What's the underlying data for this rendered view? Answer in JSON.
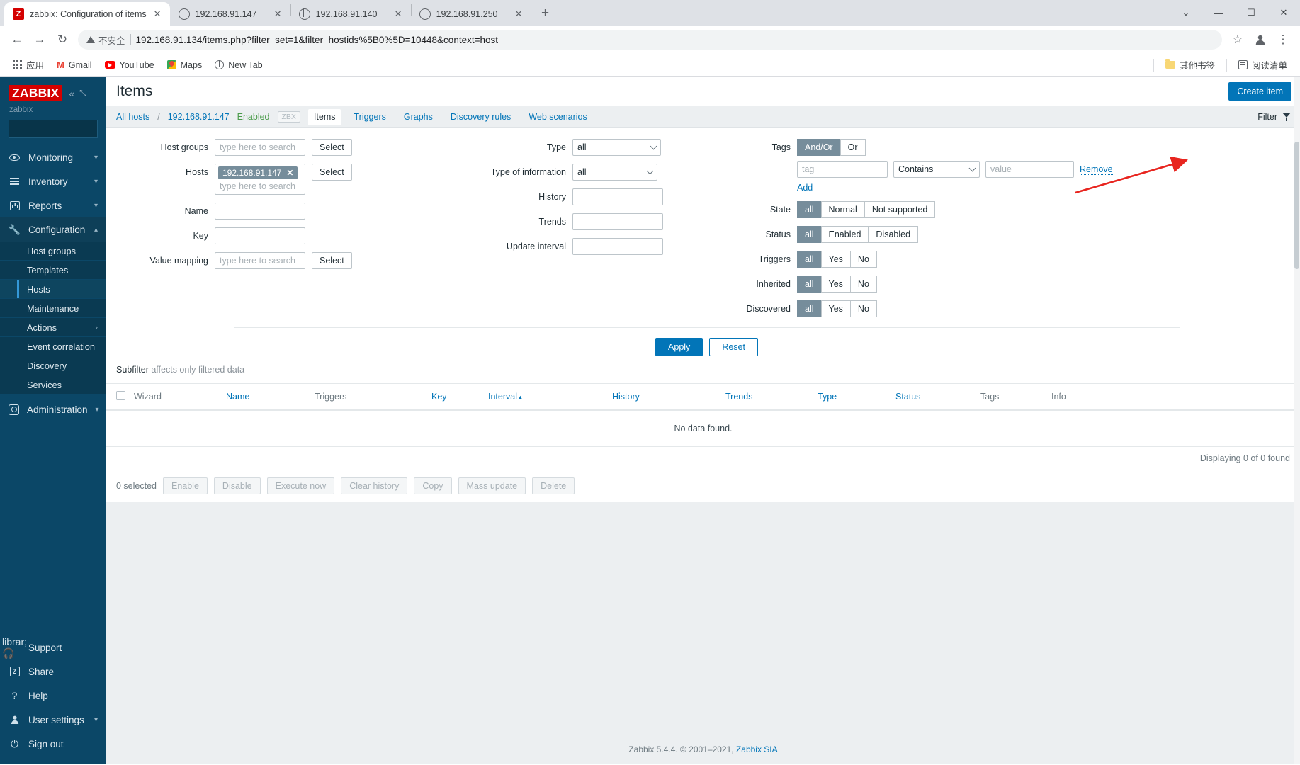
{
  "browser": {
    "tabs": [
      {
        "title": "zabbix: Configuration of items",
        "favicon": "zabbix-favicon",
        "active": true,
        "close": "✕"
      },
      {
        "title": "192.168.91.147",
        "favicon": "globe-favicon",
        "active": false,
        "close": "✕"
      },
      {
        "title": "192.168.91.140",
        "favicon": "globe-favicon",
        "active": false,
        "close": "✕"
      },
      {
        "title": "192.168.91.250",
        "favicon": "globe-favicon",
        "active": false,
        "close": "✕"
      }
    ],
    "new_tab": "+",
    "window_controls": {
      "minimize": "—",
      "maximize": "☐",
      "close": "✕",
      "tab_search": "⌄"
    },
    "nav": {
      "back": "←",
      "forward": "→",
      "reload": "↻"
    },
    "omnibox": {
      "security_label": "不安全",
      "url": "192.168.91.134/items.php?filter_set=1&filter_hostids%5B0%5D=10448&context=host",
      "bookmark_star": "☆",
      "profile_icon": "profile-icon",
      "menu_icon": "⋮"
    },
    "bookmarks": [
      {
        "label": "应用",
        "icon": "apps-grid-icon"
      },
      {
        "label": "Gmail",
        "icon": "gmail-icon"
      },
      {
        "label": "YouTube",
        "icon": "youtube-icon"
      },
      {
        "label": "Maps",
        "icon": "maps-icon"
      },
      {
        "label": "New Tab",
        "icon": "globe-icon"
      }
    ],
    "bookmarks_right": [
      {
        "label": "其他书签",
        "icon": "folder-icon"
      },
      {
        "label": "阅读清单",
        "icon": "reading-list-icon"
      }
    ]
  },
  "sidebar": {
    "logo": "ZABBIX",
    "user": "zabbix",
    "search_placeholder": "",
    "collapse_icon": "«",
    "expand_icon": "⤡",
    "items": [
      {
        "label": "Monitoring",
        "icon": "eye-icon",
        "expandable": true
      },
      {
        "label": "Inventory",
        "icon": "list-icon",
        "expandable": true
      },
      {
        "label": "Reports",
        "icon": "chart-bar-icon",
        "expandable": true
      },
      {
        "label": "Configuration",
        "icon": "wrench-icon",
        "expandable": true,
        "open": true
      },
      {
        "label": "Administration",
        "icon": "gear-square-icon",
        "expandable": true
      }
    ],
    "configuration_submenu": [
      {
        "label": "Host groups",
        "active": false
      },
      {
        "label": "Templates",
        "active": false
      },
      {
        "label": "Hosts",
        "active": true
      },
      {
        "label": "Maintenance",
        "active": false
      },
      {
        "label": "Actions",
        "active": false,
        "expandable": true
      },
      {
        "label": "Event correlation",
        "active": false
      },
      {
        "label": "Discovery",
        "active": false
      },
      {
        "label": "Services",
        "active": false
      }
    ],
    "bottom_items": [
      {
        "label": "Support",
        "icon": "headset-icon"
      },
      {
        "label": "Share",
        "icon": "zabbix-share-icon"
      },
      {
        "label": "Help",
        "icon": "question-icon"
      },
      {
        "label": "User settings",
        "icon": "user-icon",
        "expandable": true
      },
      {
        "label": "Sign out",
        "icon": "power-icon"
      }
    ]
  },
  "header": {
    "title": "Items",
    "create_button": "Create item"
  },
  "breadcrumb": {
    "all_hosts": "All hosts",
    "separator": "/",
    "host": "192.168.91.147",
    "status": "Enabled",
    "badge": "ZBX",
    "tabs": [
      {
        "label": "Items",
        "active": true
      },
      {
        "label": "Triggers",
        "active": false
      },
      {
        "label": "Graphs",
        "active": false
      },
      {
        "label": "Discovery rules",
        "active": false
      },
      {
        "label": "Web scenarios",
        "active": false
      }
    ],
    "filter_label": "Filter",
    "filter_icon": "funnel-icon"
  },
  "filter": {
    "col1": {
      "host_groups": {
        "label": "Host groups",
        "placeholder": "type here to search",
        "value": "",
        "select_button": "Select"
      },
      "hosts": {
        "label": "Hosts",
        "chip": "192.168.91.147",
        "chip_remove": "✕",
        "placeholder": "type here to search",
        "select_button": "Select"
      },
      "name": {
        "label": "Name",
        "value": ""
      },
      "key": {
        "label": "Key",
        "value": ""
      },
      "value_mapping": {
        "label": "Value mapping",
        "placeholder": "type here to search",
        "value": "",
        "select_button": "Select"
      }
    },
    "col2": {
      "type": {
        "label": "Type",
        "value": "all"
      },
      "type_of_information": {
        "label": "Type of information",
        "value": "all"
      },
      "history": {
        "label": "History",
        "value": ""
      },
      "trends": {
        "label": "Trends",
        "value": ""
      },
      "update_interval": {
        "label": "Update interval",
        "value": ""
      }
    },
    "col3": {
      "tags": {
        "label": "Tags",
        "operators": [
          {
            "label": "And/Or",
            "selected": true
          },
          {
            "label": "Or",
            "selected": false
          }
        ],
        "tag_placeholder": "tag",
        "condition": "Contains",
        "value_placeholder": "value",
        "remove_link": "Remove",
        "add_link": "Add"
      },
      "state": {
        "label": "State",
        "options": [
          {
            "label": "all",
            "selected": true
          },
          {
            "label": "Normal",
            "selected": false
          },
          {
            "label": "Not supported",
            "selected": false
          }
        ]
      },
      "status": {
        "label": "Status",
        "options": [
          {
            "label": "all",
            "selected": true
          },
          {
            "label": "Enabled",
            "selected": false
          },
          {
            "label": "Disabled",
            "selected": false
          }
        ]
      },
      "triggers": {
        "label": "Triggers",
        "options": [
          {
            "label": "all",
            "selected": true
          },
          {
            "label": "Yes",
            "selected": false
          },
          {
            "label": "No",
            "selected": false
          }
        ]
      },
      "inherited": {
        "label": "Inherited",
        "options": [
          {
            "label": "all",
            "selected": true
          },
          {
            "label": "Yes",
            "selected": false
          },
          {
            "label": "No",
            "selected": false
          }
        ]
      },
      "discovered": {
        "label": "Discovered",
        "options": [
          {
            "label": "all",
            "selected": true
          },
          {
            "label": "Yes",
            "selected": false
          },
          {
            "label": "No",
            "selected": false
          }
        ]
      }
    },
    "apply_button": "Apply",
    "reset_button": "Reset"
  },
  "subfilter": {
    "title": "Subfilter",
    "note": "affects only filtered data"
  },
  "table": {
    "columns": [
      {
        "label": "Wizard",
        "link": false
      },
      {
        "label": "Name",
        "link": true
      },
      {
        "label": "Triggers",
        "link": false
      },
      {
        "label": "Key",
        "link": true
      },
      {
        "label": "Interval",
        "link": true,
        "sort": "▲"
      },
      {
        "label": "History",
        "link": true
      },
      {
        "label": "Trends",
        "link": true
      },
      {
        "label": "Type",
        "link": true
      },
      {
        "label": "Status",
        "link": true
      },
      {
        "label": "Tags",
        "link": false
      },
      {
        "label": "Info",
        "link": false
      }
    ],
    "empty_message": "No data found.",
    "displaying": "Displaying 0 of 0 found"
  },
  "actions": {
    "selected_count": "0 selected",
    "buttons": [
      "Enable",
      "Disable",
      "Execute now",
      "Clear history",
      "Copy",
      "Mass update",
      "Delete"
    ]
  },
  "footer": {
    "text": "Zabbix 5.4.4. © 2001–2021, ",
    "link": "Zabbix SIA"
  },
  "annotation": {
    "type": "red-arrow",
    "color": "#e8251f",
    "points_to": "Create item"
  }
}
